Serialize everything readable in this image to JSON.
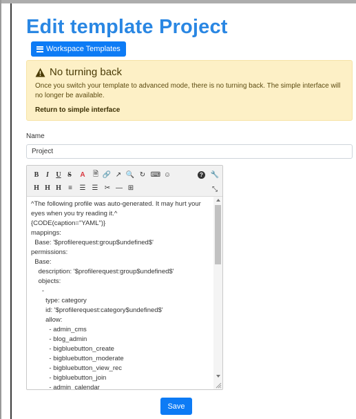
{
  "page": {
    "title": "Edit template Project"
  },
  "workspace_button": {
    "label": "Workspace Templates",
    "icon": "list-icon"
  },
  "alert": {
    "icon": "warning-icon",
    "title": "No turning back",
    "text": "Once you switch your template to advanced mode, there is no turning back. The simple interface will no longer be available.",
    "link": "Return to simple interface"
  },
  "form": {
    "name_label": "Name",
    "name_value": "Project"
  },
  "editor": {
    "toolbar_row1": [
      "B",
      "I",
      "U",
      "S",
      "A",
      "🗎",
      "🔗",
      "↗",
      "🔍",
      "↻",
      "⌨",
      "☺"
    ],
    "toolbar_row1_right": [
      "?",
      "🔧"
    ],
    "toolbar_row2": [
      "H",
      "H",
      "H",
      "≡",
      "☰",
      "☰",
      "✂",
      "—",
      "⊞"
    ],
    "toolbar_row2_right": [
      "⤡"
    ],
    "content": "^The following profile was auto-generated. It may hurt your eyes when you try reading it.^\n{CODE(caption=\"YAML\")}\nmappings:\n  Base: '$profilerequest:group$undefined$'\npermissions:\n  Base:\n    description: '$profilerequest:group$undefined$'\n    objects:\n      -\n        type: category\n        id: '$profilerequest:category$undefined$'\n        allow:\n          - admin_cms\n          - blog_admin\n          - bigbluebutton_create\n          - bigbluebutton_moderate\n          - bigbluebutton_view_rec\n          - bigbluebutton_join\n          - admin_calendar"
  },
  "save_button": {
    "label": "Save"
  },
  "colors": {
    "primary": "#0d7bf5",
    "title": "#2a87e3",
    "alert_bg": "#fdf0c6"
  }
}
